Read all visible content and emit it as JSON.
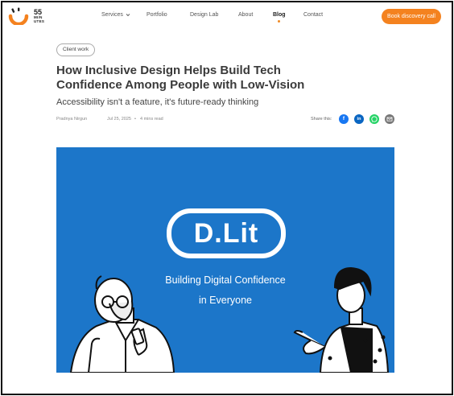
{
  "logo": {
    "number": "55",
    "word1": "MI/N",
    "word2": "UTES"
  },
  "nav": {
    "items": [
      {
        "label": "Services",
        "has_dropdown": true
      },
      {
        "label": "Portfolio"
      },
      {
        "label": "Design Lab"
      },
      {
        "label": "About"
      },
      {
        "label": "Blog",
        "active": true
      },
      {
        "label": "Contact"
      }
    ],
    "cta_label": "Book discovery call"
  },
  "article": {
    "tag": "Client work",
    "title_line1": "How Inclusive Design Helps Build Tech",
    "title_line2": "Confidence Among People with Low-Vision",
    "subtitle": "Accessibility isn't a feature, it's future-ready thinking",
    "author": "Pradnya Nirgun",
    "date": "Jul 25, 2025",
    "separator": "•",
    "read_time": "4 mins read",
    "share_label": "Share this:",
    "share_icons": [
      "facebook-icon",
      "linkedin-icon",
      "whatsapp-icon",
      "email-icon"
    ]
  },
  "hero": {
    "badge": "D.Lit",
    "line1": "Building Digital Confidence",
    "line2": "in Everyone"
  },
  "colors": {
    "accent": "#f4821f",
    "hero_bg": "#1c76c9",
    "facebook": "#1877f2",
    "linkedin": "#0a66c2",
    "whatsapp": "#25d366",
    "email": "#777777"
  }
}
